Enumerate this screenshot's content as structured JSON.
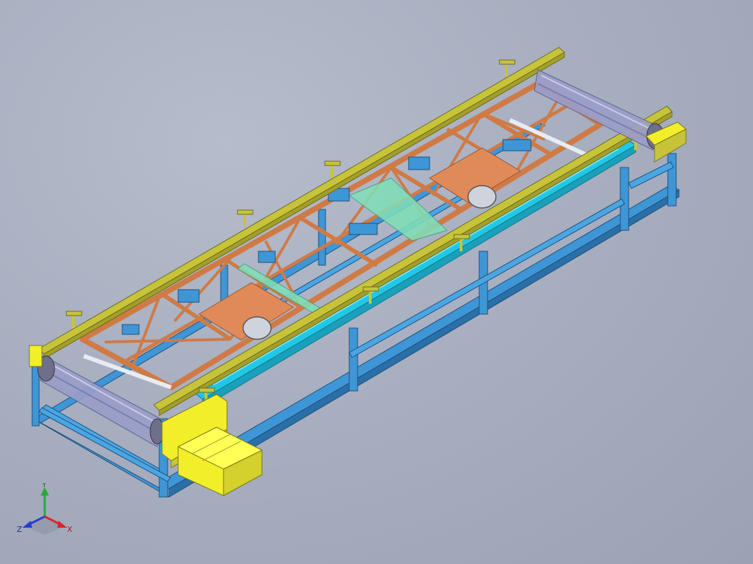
{
  "viewport": {
    "background_colors": [
      "#b5bccb",
      "#9aa2b4"
    ]
  },
  "model": {
    "description_colors": {
      "frame_blue": "#3f96d6",
      "frame_blue_dark": "#2a6fa8",
      "rail_cyan": "#21c8e6",
      "truss_orange": "#d07a45",
      "plate_orange": "#e08a5a",
      "guide_yellow": "#c8c43a",
      "motor_yellow": "#f2ee2a",
      "roller_violet": "#9a9ec8",
      "rod_white": "#e8ecf2",
      "green_panel": "#7fe0b8"
    }
  },
  "triad": {
    "x_label": "X",
    "y_label": "Y",
    "z_label": "Z",
    "x_color": "#d8262b",
    "y_color": "#2aa83a",
    "z_color": "#2a3ed0"
  }
}
